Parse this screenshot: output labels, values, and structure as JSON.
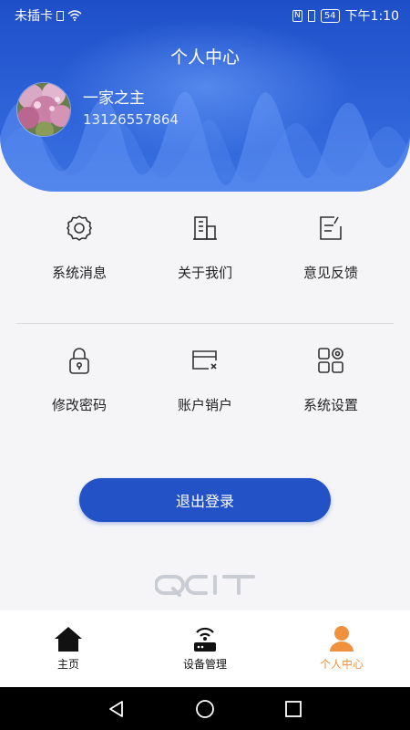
{
  "statusbar": {
    "carrier": "未插卡",
    "battery": "54",
    "time": "下午1:10"
  },
  "header": {
    "title": "个人中心",
    "user_name": "一家之主",
    "user_phone": "13126557864"
  },
  "menu": {
    "row1": [
      {
        "label": "系统消息",
        "icon": "gear-icon"
      },
      {
        "label": "关于我们",
        "icon": "building-icon"
      },
      {
        "label": "意见反馈",
        "icon": "feedback-edit-icon"
      }
    ],
    "row2": [
      {
        "label": "修改密码",
        "icon": "lock-icon"
      },
      {
        "label": "账户销户",
        "icon": "card-close-icon"
      },
      {
        "label": "系统设置",
        "icon": "apps-settings-icon"
      }
    ]
  },
  "logout_label": "退出登录",
  "logo_text": "QCIT",
  "tabs": [
    {
      "label": "主页",
      "icon": "home-icon"
    },
    {
      "label": "设备管理",
      "icon": "router-icon"
    },
    {
      "label": "个人中心",
      "icon": "person-icon",
      "active": true
    }
  ],
  "colors": {
    "header_blue": "#2352c6",
    "active_tab": "#f0913e"
  }
}
